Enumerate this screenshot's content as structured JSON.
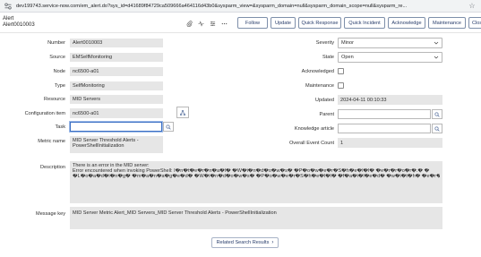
{
  "browser": {
    "url": "dev199743.service-now.com/em_alert.do?sys_id=d41689f84729ca509666a464116d43b0&sysparm_view=&sysparm_domain=null&sysparm_domain_scope=null&sysparm_re..."
  },
  "header": {
    "title_line1": "Alert",
    "title_line2": "Alert0010003",
    "icons": [
      "paperclip-icon",
      "activity-icon",
      "settings-sliders-icon",
      "more-icon"
    ],
    "buttons": [
      "Follow",
      "Update",
      "Quick Response",
      "Quick Incident",
      "Acknowledge",
      "Maintenance",
      "Clos"
    ]
  },
  "form": {
    "left": {
      "number": {
        "label": "Number",
        "value": "Alert0010003"
      },
      "source": {
        "label": "Source",
        "value": "EMSelfMonitoring"
      },
      "node": {
        "label": "Node",
        "value": "nc6500-a01"
      },
      "type": {
        "label": "Type",
        "value": "SelfMonitoring"
      },
      "resource": {
        "label": "Resource",
        "value": "MID Servers"
      },
      "ci": {
        "label": "Configuration item",
        "value": "nc6500-a01"
      },
      "task": {
        "label": "Task",
        "value": ""
      },
      "metric": {
        "label": "Metric name",
        "value": "MID Server Threshold Alerts - PowerShellInitialization"
      }
    },
    "right": {
      "severity": {
        "label": "Severity",
        "value": "Minor"
      },
      "state": {
        "label": "State",
        "value": "Open"
      },
      "acknowledged": {
        "label": "Acknowledged",
        "checked": false
      },
      "maintenance": {
        "label": "Maintenance",
        "checked": false
      },
      "updated": {
        "label": "Updated",
        "value": "2024-04-11 00:10:33"
      },
      "parent": {
        "label": "Parent",
        "value": ""
      },
      "kb": {
        "label": "Knowledge article",
        "value": ""
      },
      "event_count": {
        "label": "Overall Event Count",
        "value": "1"
      }
    },
    "description": {
      "label": "Description",
      "lines": [
        "There is an error in the MID server:",
        "Error encountered when invoking PowerShell: I�n�t�e�r�n�a�l� �W�i�n�d�o�w�s� �P�o�w�e�r�S�h�e�l�l� �e�r�r�o�r�.� �",
        "�L�o�a�d�i�n�g� �m�a�n�a�g�e�d� �W�i�n�d�o�w�s� �P�o�w�e�r�S�h�e�l�l� �f�a�i�l�e�d� �w�i�t�h� �e�r�r�o�r� �8�0�0�0�7�0�0�5�a�e�.�"
      ]
    },
    "message_key": {
      "label": "Message key",
      "value": "MID Server Metric Alert_MID Servers_MID Server Threshold Alerts - PowerShellInitialization"
    }
  },
  "footer": {
    "related_label": "Related Search Results",
    "related_icon": "chevron-right-icon"
  },
  "colors": {
    "field_bg": "#e6e6e6",
    "button_text": "#283d6b",
    "button_border": "#7e8faa"
  }
}
